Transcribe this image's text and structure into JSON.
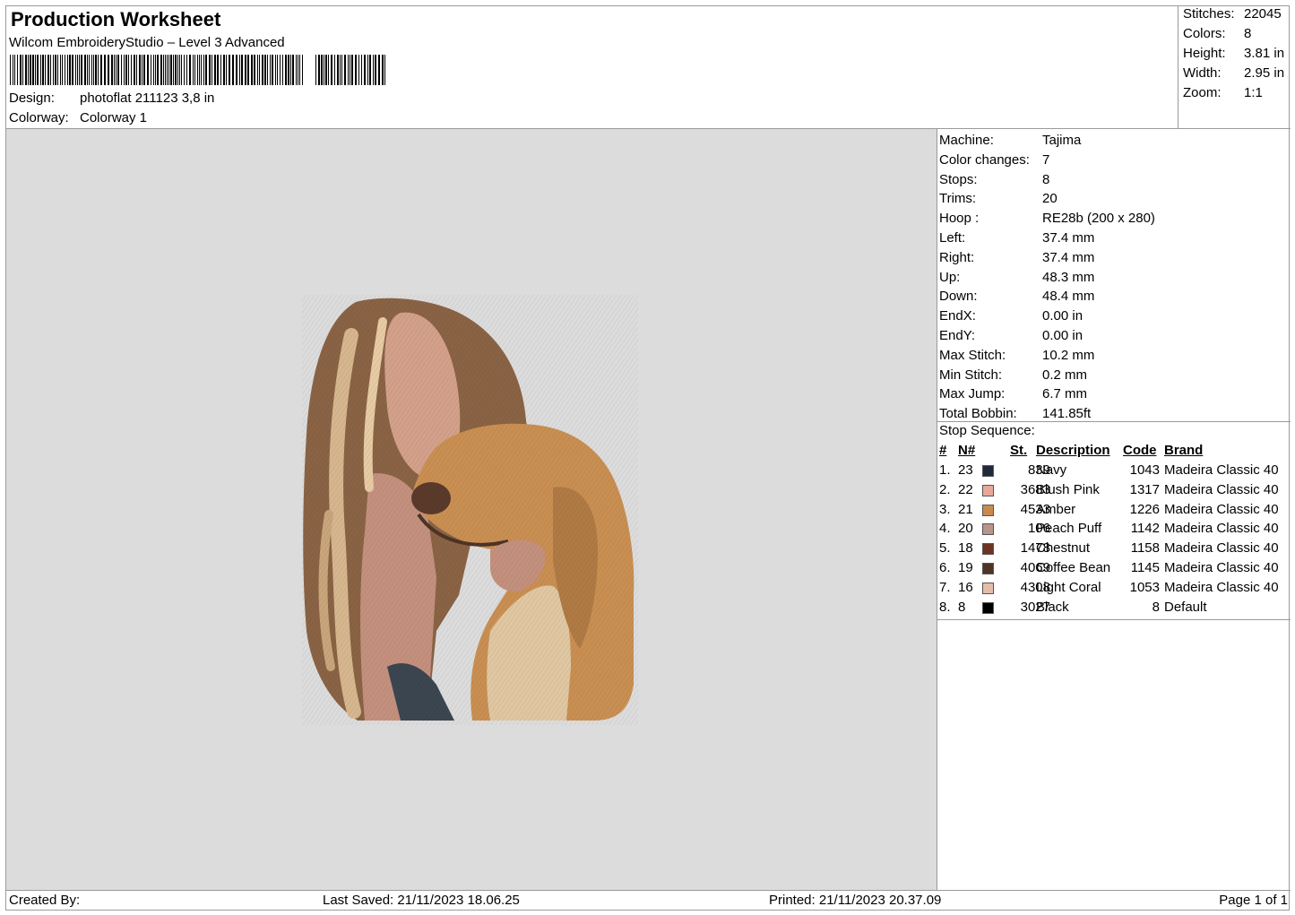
{
  "header": {
    "title": "Production Worksheet",
    "subtitle": "Wilcom EmbroideryStudio – Level 3 Advanced",
    "design_label": "Design:",
    "design_value": "photoflat 211123 3,8 in",
    "colorway_label": "Colorway:",
    "colorway_value": "Colorway 1"
  },
  "header_stats": [
    {
      "label": "Stitches:",
      "value": "22045"
    },
    {
      "label": "Colors:",
      "value": "8"
    },
    {
      "label": "Height:",
      "value": "3.81 in"
    },
    {
      "label": "Width:",
      "value": "2.95 in"
    },
    {
      "label": "Zoom:",
      "value": "1:1"
    }
  ],
  "machine_info": [
    {
      "label": "Machine:",
      "value": "Tajima"
    },
    {
      "label": "Color changes:",
      "value": "7"
    },
    {
      "label": "Stops:",
      "value": "8"
    },
    {
      "label": "Trims:",
      "value": "20"
    },
    {
      "label": "Hoop :",
      "value": "RE28b (200 x 280)"
    },
    {
      "label": "Left:",
      "value": "37.4 mm"
    },
    {
      "label": "Right:",
      "value": "37.4 mm"
    },
    {
      "label": "Up:",
      "value": "48.3 mm"
    },
    {
      "label": "Down:",
      "value": "48.4 mm"
    },
    {
      "label": "EndX:",
      "value": "0.00 in"
    },
    {
      "label": "EndY:",
      "value": "0.00 in"
    },
    {
      "label": "Max Stitch:",
      "value": "10.2 mm"
    },
    {
      "label": "Min Stitch:",
      "value": "0.2 mm"
    },
    {
      "label": "Max Jump:",
      "value": "6.7 mm"
    },
    {
      "label": "Total Bobbin:",
      "value": "141.85ft"
    }
  ],
  "stop_sequence": {
    "title": "Stop Sequence:",
    "headers": {
      "num": "#",
      "n": "N#",
      "st": "St.",
      "desc": "Description",
      "code": "Code",
      "brand": "Brand"
    },
    "rows": [
      {
        "num": "1.",
        "n": "23",
        "color": "#1f2a3a",
        "st": "839",
        "desc": "Navy",
        "code": "1043",
        "brand": "Madeira Classic 40"
      },
      {
        "num": "2.",
        "n": "22",
        "color": "#e8a898",
        "st": "3683",
        "desc": "Blush Pink",
        "code": "1317",
        "brand": "Madeira Classic 40"
      },
      {
        "num": "3.",
        "n": "21",
        "color": "#c98a4e",
        "st": "4533",
        "desc": "Amber",
        "code": "1226",
        "brand": "Madeira Classic 40"
      },
      {
        "num": "4.",
        "n": "20",
        "color": "#b8958a",
        "st": "106",
        "desc": "Peach Puff",
        "code": "1142",
        "brand": "Madeira Classic 40"
      },
      {
        "num": "5.",
        "n": "18",
        "color": "#6e3422",
        "st": "1478",
        "desc": "Chestnut",
        "code": "1158",
        "brand": "Madeira Classic 40"
      },
      {
        "num": "6.",
        "n": "19",
        "color": "#4e3326",
        "st": "4069",
        "desc": "Coffee Bean",
        "code": "1145",
        "brand": "Madeira Classic 40"
      },
      {
        "num": "7.",
        "n": "16",
        "color": "#e6bca8",
        "st": "4308",
        "desc": "Light Coral",
        "code": "1053",
        "brand": "Madeira Classic 40"
      },
      {
        "num": "8.",
        "n": "8",
        "color": "#000000",
        "st": "3027",
        "desc": "Black",
        "code": "8",
        "brand": "Default"
      }
    ]
  },
  "footer": {
    "created_by": "Created By:",
    "last_saved": "Last Saved: 21/11/2023 18.06.25",
    "printed": "Printed: 21/11/2023 20.37.09",
    "page": "Page 1 of 1"
  }
}
